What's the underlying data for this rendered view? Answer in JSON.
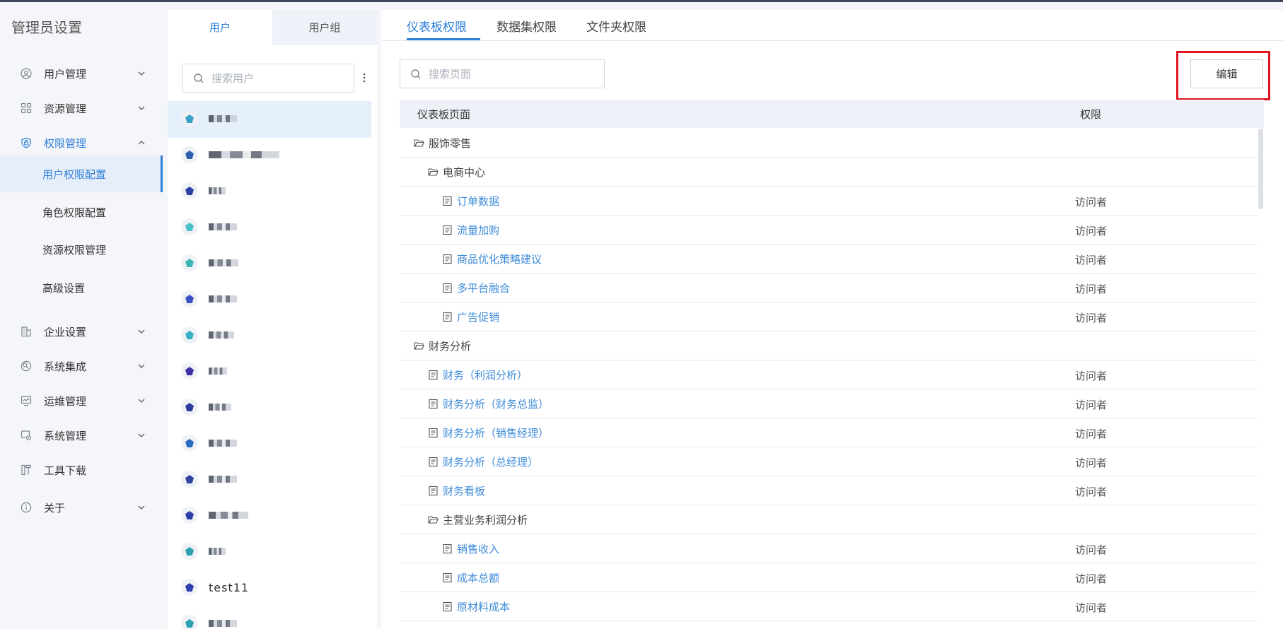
{
  "sidebar": {
    "title": "管理员设置",
    "items": [
      {
        "label": "用户管理",
        "icon": "user-circle-icon",
        "expanded": false
      },
      {
        "label": "资源管理",
        "icon": "grid-icon",
        "expanded": false
      },
      {
        "label": "权限管理",
        "icon": "shield-icon",
        "expanded": true
      },
      {
        "label": "企业设置",
        "icon": "building-icon",
        "expanded": false
      },
      {
        "label": "系统集成",
        "icon": "integration-icon",
        "expanded": false
      },
      {
        "label": "运维管理",
        "icon": "monitor-icon",
        "expanded": false
      },
      {
        "label": "系统管理",
        "icon": "system-gear-icon",
        "expanded": false
      },
      {
        "label": "工具下载",
        "icon": "download-tool-icon",
        "expanded": false
      },
      {
        "label": "关于",
        "icon": "info-icon",
        "expanded": false
      }
    ],
    "subitems": [
      {
        "label": "用户权限配置",
        "selected": true
      },
      {
        "label": "角色权限配置",
        "selected": false
      },
      {
        "label": "资源权限管理",
        "selected": false
      },
      {
        "label": "高级设置",
        "selected": false
      }
    ]
  },
  "user_panel": {
    "tabs": [
      {
        "label": "用户",
        "active": true
      },
      {
        "label": "用户组",
        "active": false
      }
    ],
    "search_placeholder": "搜索用户",
    "users": [
      {
        "name": "",
        "selected": true,
        "avatar_color": "#3aa0c8"
      },
      {
        "name": "",
        "avatar_color": "#2f5fb0"
      },
      {
        "name": "",
        "avatar_color": "#2a3fa0"
      },
      {
        "name": "",
        "avatar_color": "#49c0c8"
      },
      {
        "name": "",
        "avatar_color": "#3ab6b6"
      },
      {
        "name": "",
        "avatar_color": "#3a4fc0"
      },
      {
        "name": "",
        "avatar_color": "#36b2c2"
      },
      {
        "name": "",
        "avatar_color": "#4030a8"
      },
      {
        "name": "",
        "avatar_color": "#2e3a9c"
      },
      {
        "name": "",
        "avatar_color": "#2a6cc0"
      },
      {
        "name": "",
        "avatar_color": "#3044a0"
      },
      {
        "name": "",
        "avatar_color": "#2f3fa8"
      },
      {
        "name": "",
        "avatar_color": "#2aa0b0"
      },
      {
        "name": "test11",
        "avatar_color": "#2f3fb0"
      },
      {
        "name": "",
        "avatar_color": "#2aa0b0"
      }
    ]
  },
  "main": {
    "tabs": [
      {
        "label": "仪表板权限",
        "active": true
      },
      {
        "label": "数据集权限",
        "active": false
      },
      {
        "label": "文件夹权限",
        "active": false
      }
    ],
    "search_placeholder": "搜索页面",
    "edit_label": "编辑",
    "table": {
      "headers": [
        "仪表板页面",
        "权限"
      ],
      "rows": [
        {
          "type": "folder",
          "level": 0,
          "name": "服饰零售",
          "perm": ""
        },
        {
          "type": "folder",
          "level": 1,
          "name": "电商中心",
          "perm": ""
        },
        {
          "type": "page",
          "level": 2,
          "name": "订单数据",
          "perm": "访问者"
        },
        {
          "type": "page",
          "level": 2,
          "name": "流量加购",
          "perm": "访问者"
        },
        {
          "type": "page",
          "level": 2,
          "name": "商品优化策略建议",
          "perm": "访问者"
        },
        {
          "type": "page",
          "level": 2,
          "name": "多平台融合",
          "perm": "访问者"
        },
        {
          "type": "page",
          "level": 2,
          "name": "广告促销",
          "perm": "访问者"
        },
        {
          "type": "folder",
          "level": 0,
          "name": "财务分析",
          "perm": ""
        },
        {
          "type": "page",
          "level": 1,
          "name": "财务（利润分析）",
          "perm": "访问者"
        },
        {
          "type": "page",
          "level": 1,
          "name": "财务分析（财务总监）",
          "perm": "访问者"
        },
        {
          "type": "page",
          "level": 1,
          "name": "财务分析（销售经理）",
          "perm": "访问者"
        },
        {
          "type": "page",
          "level": 1,
          "name": "财务分析（总经理）",
          "perm": "访问者"
        },
        {
          "type": "page",
          "level": 1,
          "name": "财务看板",
          "perm": "访问者"
        },
        {
          "type": "folder",
          "level": 1,
          "name": "主营业务利润分析",
          "perm": ""
        },
        {
          "type": "page",
          "level": 2,
          "name": "销售收入",
          "perm": "访问者"
        },
        {
          "type": "page",
          "level": 2,
          "name": "成本总额",
          "perm": "访问者"
        },
        {
          "type": "page",
          "level": 2,
          "name": "原材料成本",
          "perm": "访问者"
        }
      ]
    }
  },
  "colors": {
    "accent": "#2f7fd8",
    "highlight": "#e0141e",
    "link": "#3d8bd8"
  }
}
